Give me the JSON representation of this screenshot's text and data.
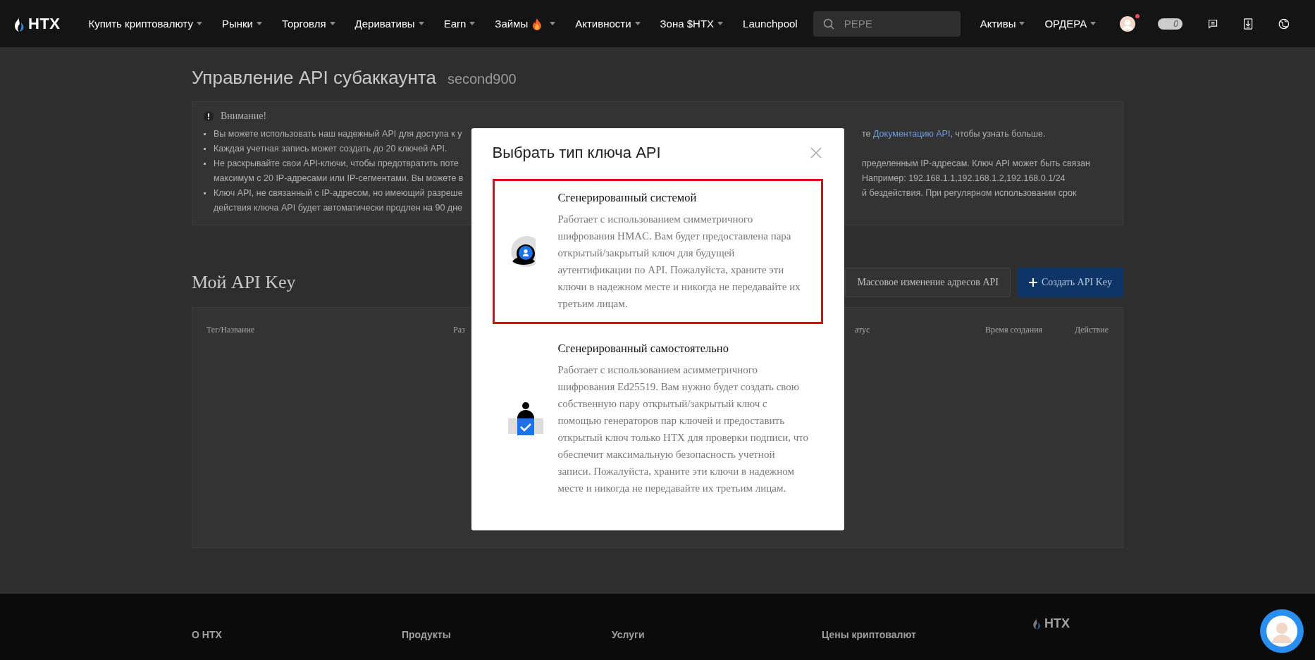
{
  "nav": {
    "logo": "HTX",
    "items": [
      {
        "label": "Купить криптовалюту",
        "caret": true,
        "fire": false
      },
      {
        "label": "Рынки",
        "caret": true,
        "fire": false
      },
      {
        "label": "Торговля",
        "caret": true,
        "fire": false
      },
      {
        "label": "Деривативы",
        "caret": true,
        "fire": false
      },
      {
        "label": "Earn",
        "caret": true,
        "fire": false
      },
      {
        "label": "Займы",
        "caret": true,
        "fire": true
      },
      {
        "label": "Активности",
        "caret": true,
        "fire": false
      },
      {
        "label": "Зона $HTX",
        "caret": true,
        "fire": false
      },
      {
        "label": "Launchpool",
        "caret": false,
        "fire": false
      }
    ],
    "search": {
      "placeholder": "PEPE"
    },
    "right_items": [
      {
        "label": "Активы",
        "caret": true
      },
      {
        "label": "ОРДЕРА",
        "caret": true
      }
    ],
    "notification_dot": true,
    "pill_count": "0"
  },
  "page": {
    "title": "Управление API субаккаунта",
    "subaccount": "second900",
    "notice": {
      "heading": "Внимание!",
      "lines": [
        {
          "bullet": true,
          "left": "Вы можете использовать наш надежный API для доступа к у",
          "right": [
            {
              "kind": "text",
              "text": "те "
            },
            {
              "kind": "link",
              "text": "Документацию API"
            },
            {
              "kind": "text",
              "text": ", чтобы узнать больше."
            }
          ]
        },
        {
          "bullet": true,
          "left": "Каждая учетная запись может создать до 20 ключей API."
        },
        {
          "bullet": true,
          "left": "Не раскрывайте свои API-ключи, чтобы предотвратить поте",
          "right": [
            {
              "kind": "text",
              "text": "пределенным IP-адресам. Ключ API может быть связан"
            }
          ]
        },
        {
          "bullet": false,
          "left": "максимум с 20 IP-адресами или IP-сегментами. Вы можете в",
          "right": [
            {
              "kind": "text",
              "text": "Например: 192.168.1.1,192.168.1.2,192.168.0.1/24"
            }
          ]
        },
        {
          "bullet": true,
          "left": "Ключ API, не связанный с IP-адресом, но имеющий разреше",
          "right": [
            {
              "kind": "text",
              "text": "й бездействия. При регулярном использовании срок"
            }
          ]
        },
        {
          "bullet": false,
          "left": "действия ключа API будет автоматически продлен на 90 дне"
        }
      ]
    },
    "keys_title": "Мой API Key",
    "buttons": [
      {
        "kind": "outline",
        "label": "Массовое изменение адресов API"
      },
      {
        "kind": "primary",
        "label": "Создать API Key"
      }
    ],
    "table": {
      "columns": [
        "Тег/Название",
        "Раз",
        "атус",
        "Время создания",
        "Действие"
      ]
    }
  },
  "footer": {
    "columns": [
      "О HTX",
      "Продукты",
      "Услуги",
      "Цены криптовалют"
    ],
    "logo": "HTX"
  },
  "modal": {
    "title": "Выбрать тип ключа API",
    "options": [
      {
        "kind": "system",
        "selected": true,
        "title": "Сгенерированный системой",
        "description": "Работает с использованием симметричного шифрования HMAC. Вам будет предоставлена пара открытый/закрытый ключ для будущей аутентификации по API. Пожалуйста, храните эти ключи в надежном месте и никогда не передавайте их третьим лицам."
      },
      {
        "kind": "self",
        "selected": false,
        "title": "Сгенерированный самостоятельно",
        "description": "Работает с использованием асимметричного шифрования Ed25519. Вам нужно будет создать свою собственную пару открытый/закрытый ключ с помощью генераторов пар ключей и предоставить открытый ключ только HTX для проверки подписи, что обеспечит максимальную безопасность учетной записи. Пожалуйста, храните эти ключи в надежном месте и никогда не передавайте их третьим лицам."
      }
    ]
  }
}
